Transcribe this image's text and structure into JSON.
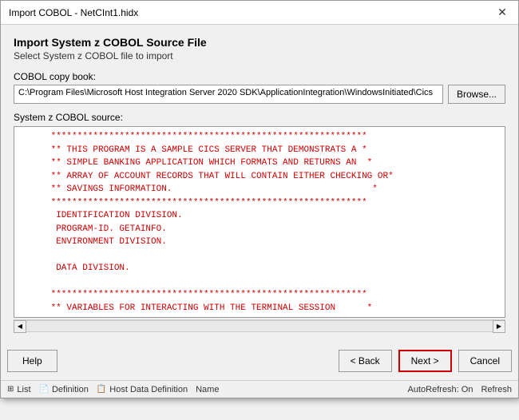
{
  "titleBar": {
    "text": "Import COBOL - NetCInt1.hidx",
    "closeLabel": "✕"
  },
  "header": {
    "title": "Import System z COBOL Source File",
    "subtitle": "Select System z COBOL file to import"
  },
  "cobolCopyBook": {
    "label": "COBOL copy book:",
    "filePath": "C:\\Program Files\\Microsoft Host Integration Server 2020 SDK\\ApplicationIntegration\\WindowsInitiated\\Cics",
    "browseLabel": "Browse..."
  },
  "systemZSource": {
    "label": "System z COBOL source:",
    "lines": [
      "      ************************************************************",
      "      ** THIS PROGRAM IS A SAMPLE CICS SERVER THAT DEMONSTRATS A *",
      "      ** SIMPLE BANKING APPLICATION WHICH FORMATS AND RETURNS AN  *",
      "      ** ARRAY OF ACCOUNT RECORDS THAT WILL CONTAIN EITHER CHECKING OR*",
      "      ** SAVINGS INFORMATION.                                      *",
      "      ************************************************************",
      "       IDENTIFICATION DIVISION.",
      "       PROGRAM-ID. GETAINFO.",
      "       ENVIRONMENT DIVISION.",
      "",
      "       DATA DIVISION.",
      "",
      "      ************************************************************",
      "      ** VARIABLES FOR INTERACTING WITH THE TERMINAL SESSION      *"
    ]
  },
  "buttons": {
    "help": "Help",
    "back": "< Back",
    "next": "Next >",
    "cancel": "Cancel"
  },
  "statusBar": {
    "listLabel": "List",
    "definitionLabel": "Definition",
    "hostDataDefinitionLabel": "Host Data Definition",
    "nameLabel": "Name",
    "autoRefreshLabel": "AutoRefresh: On",
    "refreshLabel": "Refresh"
  }
}
